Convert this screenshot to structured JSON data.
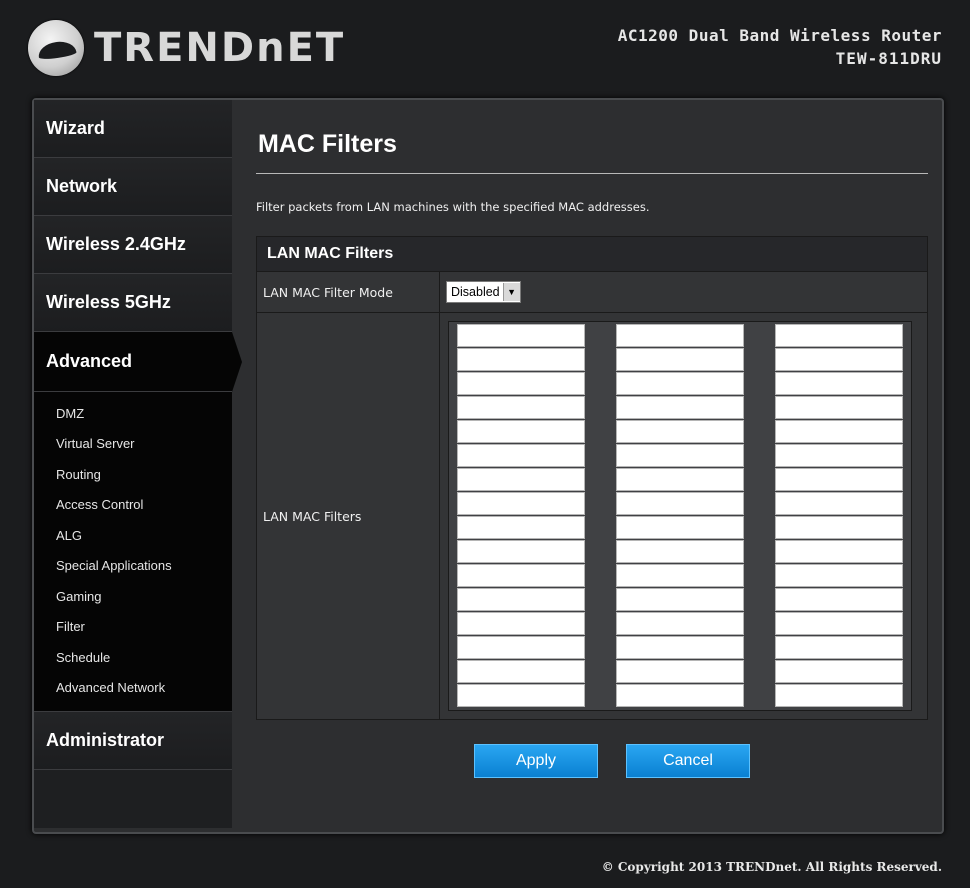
{
  "header": {
    "logo_text": "TRENDnET",
    "product_line1": "AC1200 Dual Band Wireless Router",
    "product_line2": "TEW-811DRU"
  },
  "sidebar": {
    "items": [
      {
        "label": "Wizard"
      },
      {
        "label": "Network"
      },
      {
        "label": "Wireless 2.4GHz"
      },
      {
        "label": "Wireless 5GHz"
      },
      {
        "label": "Advanced"
      },
      {
        "label": "Administrator"
      }
    ],
    "advanced_sub": [
      "DMZ",
      "Virtual Server",
      "Routing",
      "Access Control",
      "ALG",
      "Special Applications",
      "Gaming",
      "Filter",
      "Schedule",
      "Advanced Network"
    ]
  },
  "main": {
    "title": "MAC Filters",
    "description": "Filter packets from LAN machines with the specified MAC addresses.",
    "panel_title": "LAN MAC Filters",
    "mode_label": "LAN MAC Filter Mode",
    "mode_value": "Disabled",
    "filters_label": "LAN MAC Filters",
    "mac_entries": {
      "columns": 3,
      "rows_per_column": 16,
      "values": []
    }
  },
  "buttons": {
    "apply_label": "Apply",
    "cancel_label": "Cancel"
  },
  "footer": {
    "copyright": "© Copyright 2013 TRENDnet. All Rights Reserved."
  },
  "colors": {
    "accent": "#1890e0",
    "background": "#1b1c1e",
    "panel": "#333436"
  }
}
